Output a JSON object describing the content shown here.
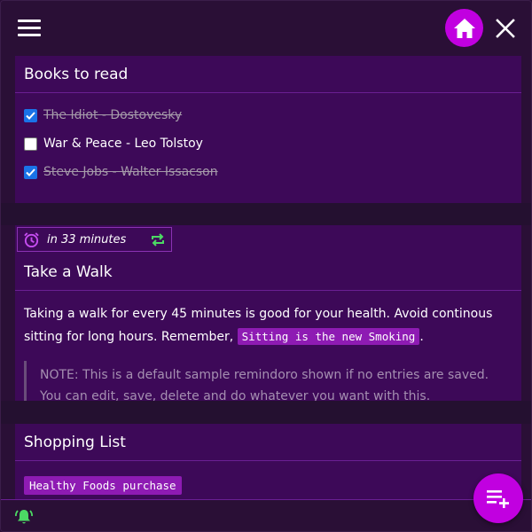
{
  "header": {
    "menu_icon": "hamburger-menu-icon",
    "home_icon": "home-icon",
    "close_icon": "close-icon"
  },
  "books_card": {
    "title": "Books to read",
    "items": [
      {
        "label": "The Idiot - Dostovesky",
        "checked": true
      },
      {
        "label": "War & Peace - Leo Tolstoy",
        "checked": false
      },
      {
        "label": "Steve Jobs - Walter Issacson",
        "checked": true
      }
    ]
  },
  "walk_card": {
    "reminder_text": "in 33 minutes",
    "reminder_icon": "alarm-clock-icon",
    "repeat_icon": "repeat-icon",
    "title": "Take a Walk",
    "body_prefix": "Taking a walk for every 45 minutes is good for your health. Avoid continous sitting for long hours. Remember,",
    "body_code": "Sitting is the new Smoking",
    "body_suffix": ".",
    "note": "NOTE: This is a default sample remindoro shown if no entries are saved. You can edit, save, delete and do whatever you want with this."
  },
  "shopping_card": {
    "title": "Shopping List",
    "tag": "Healthy Foods purchase"
  },
  "footer": {
    "bell_icon": "notification-bell-icon",
    "fab_icon": "add-list-icon"
  },
  "colors": {
    "background": "#2a0f36",
    "card": "#3d0958",
    "accent": "#c100e0",
    "code_bg": "#8e1bb3",
    "reminder_icon": "#c54cf0",
    "repeat_icon": "#4cd964",
    "bell_icon": "#4cd964",
    "checkbox_checked": "#1a73e8"
  }
}
